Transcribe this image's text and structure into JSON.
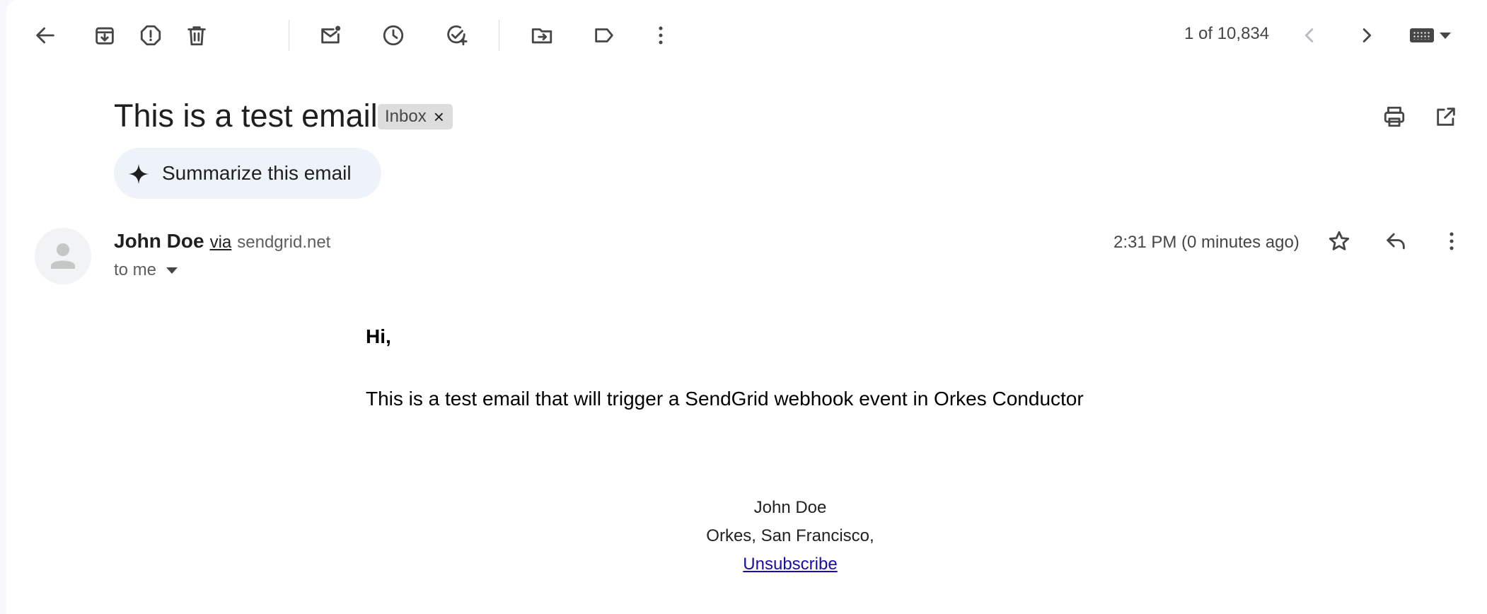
{
  "toolbar": {
    "back": "back-arrow-icon",
    "actions": [
      "archive-icon",
      "report-spam-icon",
      "delete-icon",
      "mark-unread-icon",
      "snooze-icon",
      "add-task-icon",
      "move-to-icon",
      "label-icon",
      "more-vert-icon"
    ],
    "counter": "1 of 10,834",
    "prev": "chevron-left-icon",
    "next": "chevron-right-icon",
    "input_tools": "keyboard-icon"
  },
  "email": {
    "subject": "This is a test email",
    "label_chip": "Inbox",
    "label_remove": "×",
    "summarize_label": "Summarize this email",
    "sender_name": "John Doe",
    "via": "via",
    "sender_domain": "sendgrid.net",
    "recipients": "to me",
    "time": "2:31 PM (0 minutes ago)",
    "greeting": "Hi,",
    "body": "This is a test email that will trigger a SendGrid webhook event in Orkes Conductor",
    "signature": {
      "name": "John Doe",
      "address": "Orkes, San Francisco,",
      "unsubscribe": "Unsubscribe"
    }
  },
  "colors": {
    "background": "#f6f8fc",
    "surface": "#ffffff",
    "icon": "#444746",
    "chip_bg": "#dddddd",
    "summarize_bg": "#eef2f9",
    "link": "#1a0dab"
  }
}
